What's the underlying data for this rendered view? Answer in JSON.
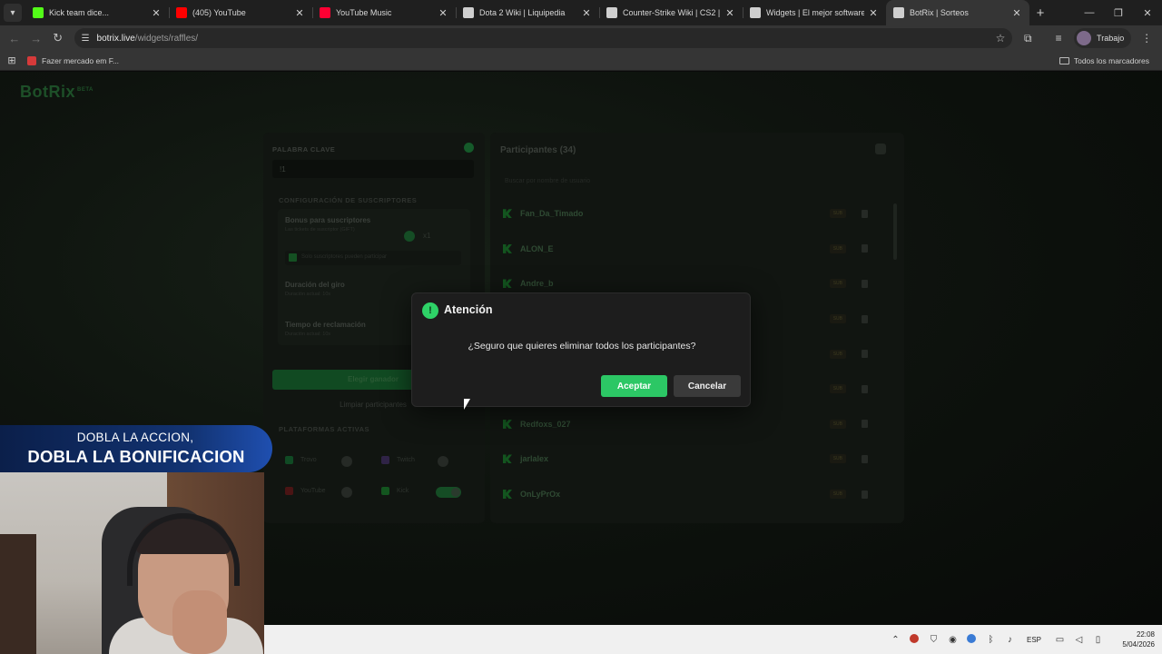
{
  "browser": {
    "tabs": [
      {
        "title": "Kick team dice...",
        "favicon_color": "#53fc18",
        "active": false
      },
      {
        "title": "(405) YouTube",
        "favicon_color": "#ff0000",
        "active": false
      },
      {
        "title": "YouTube Music",
        "favicon_color": "#ff0033",
        "active": false
      },
      {
        "title": "Dota 2 Wiki | Liquipedia",
        "favicon_color": "#cfcfcf",
        "active": false
      },
      {
        "title": "Counter-Strike Wiki | CS2 | Liqu",
        "favicon_color": "#cfcfcf",
        "active": false
      },
      {
        "title": "Widgets | El mejor software pa",
        "favicon_color": "#cfcfcf",
        "active": false
      },
      {
        "title": "BotRix | Sorteos",
        "favicon_color": "#cfcfcf",
        "active": true
      }
    ],
    "url_host": "botrix.live",
    "url_path": "/widgets/raffles/",
    "profile_label": "Trabajo",
    "bookmark_item": "Fazer mercado em F...",
    "bookmarks_all": "Todos los marcadores"
  },
  "page": {
    "logo": "BotRix",
    "logo_badge": "BETA",
    "left": {
      "keyword_label": "PALABRA CLAVE",
      "keyword_value": "!1",
      "subs_section": "CONFIGURACIÓN DE SUSCRIPTORES",
      "bonus_title": "Bonus para suscriptores",
      "bonus_sub": "Las tickets de suscriptor (GIFT)",
      "bonus_multiplier": "x1",
      "only_subs": "Solo suscriptores pueden participar",
      "spin_title": "Duración del giro",
      "spin_sub": "Duración actual: 10s",
      "claim_title": "Tiempo de reclamación",
      "claim_sub": "Duración actual: 10s",
      "pick_winner": "Elegir ganador",
      "clear_participants": "Limpiar participantes",
      "platforms_label": "PLATAFORMAS ACTIVAS",
      "platforms": [
        "Trovo",
        "Twitch",
        "YouTube",
        "Kick"
      ]
    },
    "right": {
      "title": "Participantes (34)",
      "search_placeholder": "Buscar por nombre de usuario",
      "participants": [
        {
          "name": "Fan_Da_Timado",
          "badge": "SUB"
        },
        {
          "name": "ALON_E",
          "badge": "SUB"
        },
        {
          "name": "Andre_b",
          "badge": "SUB"
        },
        {
          "name": "",
          "badge": "SUB"
        },
        {
          "name": "",
          "badge": "SUB"
        },
        {
          "name": "",
          "badge": "SUB"
        },
        {
          "name": "Redfoxs_027",
          "badge": "SUB"
        },
        {
          "name": "jarlalex",
          "badge": "SUB"
        },
        {
          "name": "OnLyPrOx",
          "badge": "SUB"
        }
      ]
    }
  },
  "modal": {
    "icon": "!",
    "title": "Atención",
    "message": "¿Seguro que quieres eliminar todos los participantes?",
    "accept": "Aceptar",
    "cancel": "Cancelar"
  },
  "overlay": {
    "line1": "DOBLA LA ACCION,",
    "line2": "DOBLA LA BONIFICACION"
  },
  "taskbar": {
    "lang": "ESP",
    "time": "22:08",
    "date": "5/04/2026"
  },
  "colors": {
    "accent_green": "#2cc765",
    "modal_bg": "#1d1d1d",
    "banner_blue": "#123372"
  }
}
